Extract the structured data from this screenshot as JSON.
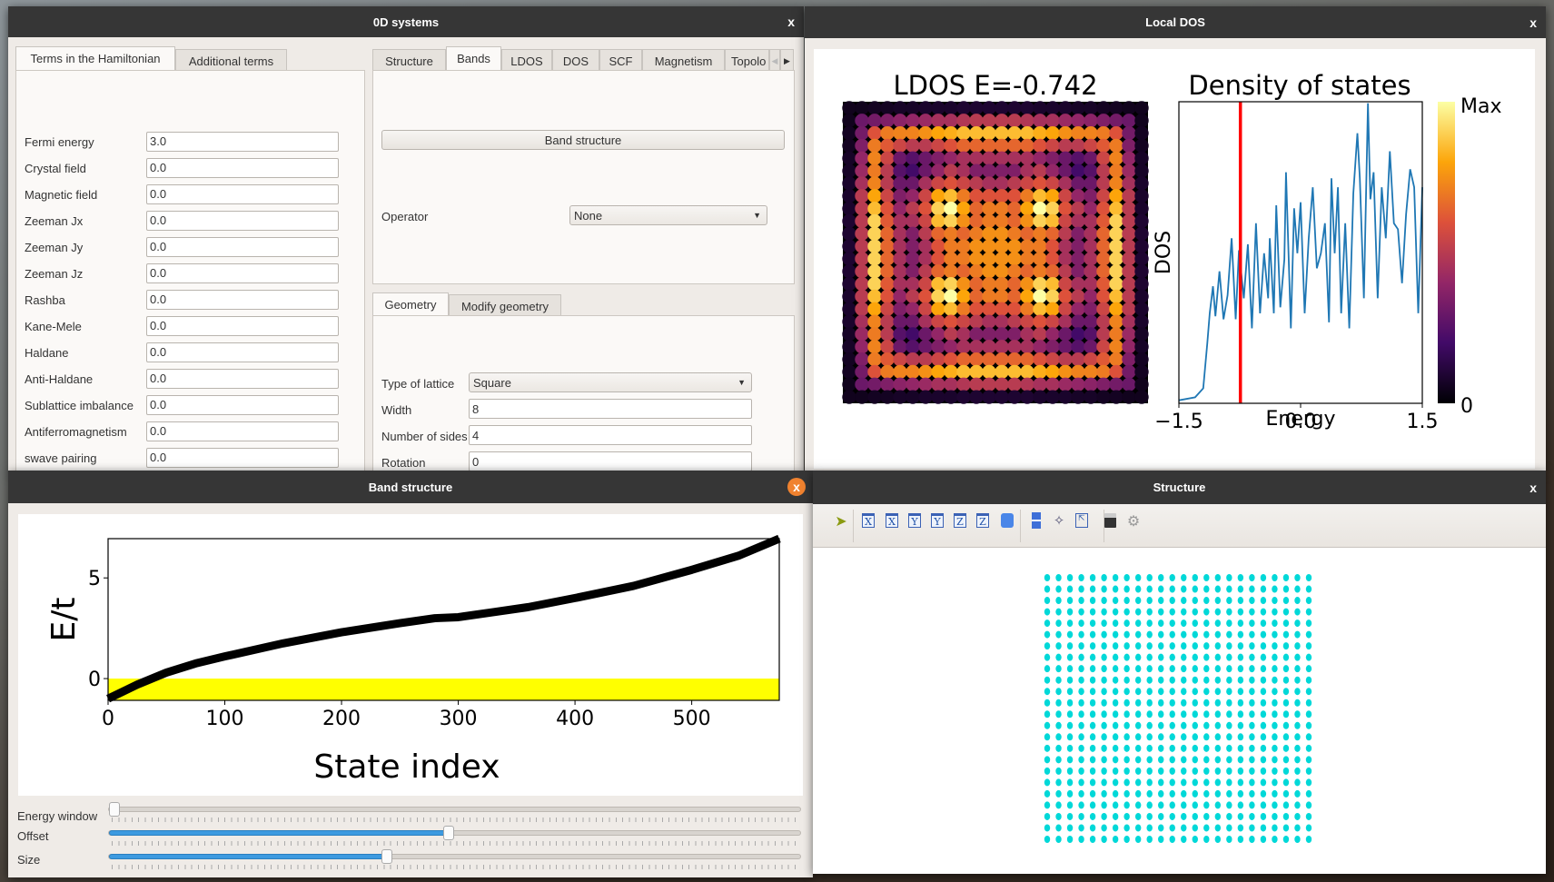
{
  "windows": {
    "systems": {
      "title": "0D systems"
    },
    "ldos": {
      "title": "Local DOS"
    },
    "bands": {
      "title": "Band structure"
    },
    "structure": {
      "title": "Structure"
    }
  },
  "close_glyph": "x",
  "left_tabs": [
    "Terms in the Hamiltonian",
    "Additional terms"
  ],
  "hamiltonian": [
    {
      "label": "Fermi energy",
      "value": "3.0"
    },
    {
      "label": "Crystal field",
      "value": "0.0"
    },
    {
      "label": "Magnetic field",
      "value": "0.0"
    },
    {
      "label": "Zeeman Jx",
      "value": "0.0"
    },
    {
      "label": "Zeeman Jy",
      "value": "0.0"
    },
    {
      "label": "Zeeman Jz",
      "value": "0.0"
    },
    {
      "label": "Rashba",
      "value": "0.0"
    },
    {
      "label": "Kane-Mele",
      "value": "0.0"
    },
    {
      "label": "Haldane",
      "value": "0.0"
    },
    {
      "label": "Anti-Haldane",
      "value": "0.0"
    },
    {
      "label": "Sublattice imbalance",
      "value": "0.0"
    },
    {
      "label": "Antiferromagnetism",
      "value": "0.0"
    },
    {
      "label": "swave pairing",
      "value": "0.0"
    }
  ],
  "right_tabs": [
    "Structure",
    "Bands",
    "LDOS",
    "DOS",
    "SCF",
    "Magnetism",
    "Topolo"
  ],
  "bands_tab": {
    "button": "Band structure",
    "operator_label": "Operator",
    "operator_value": "None"
  },
  "geometry_tabs": [
    "Geometry",
    "Modify geometry"
  ],
  "geometry": {
    "lattice_label": "Type of lattice",
    "lattice_value": "Square",
    "fields": [
      {
        "label": "Width",
        "value": "8"
      },
      {
        "label": "Number of sides",
        "value": "4"
      },
      {
        "label": "Rotation",
        "value": "0"
      }
    ]
  },
  "sliders": [
    {
      "label": "Energy window",
      "value": 0.0
    },
    {
      "label": "Offset",
      "value": 0.49
    },
    {
      "label": "Size",
      "value": 0.4
    }
  ],
  "structure_toolbar": [
    "select-icon",
    "view-x-icon",
    "view-minus-x-icon",
    "view-y-icon",
    "view-minus-y-icon",
    "view-z-icon",
    "view-minus-z-icon",
    "perspective-cube-icon",
    "layout-icon",
    "axes-icon",
    "fit-view-icon",
    "save-icon",
    "settings-icon"
  ],
  "structure_toolbar_glyphs": [
    "",
    "X",
    "X",
    "Y",
    "Y",
    "Z",
    "Z",
    "",
    "",
    "",
    "",
    "",
    ""
  ],
  "structure_lattice": {
    "rows": 24,
    "cols": 24,
    "color": "#00d8d8"
  },
  "chart_data": [
    {
      "type": "line",
      "id": "band-structure",
      "xlabel": "State index",
      "ylabel": "E/t",
      "xlim": [
        0,
        575
      ],
      "ylim": [
        -1.08,
        6.95
      ],
      "xticks": [
        0,
        100,
        200,
        300,
        400,
        500
      ],
      "yticks": [
        0,
        5
      ],
      "x": [
        0,
        25,
        50,
        75,
        100,
        150,
        200,
        250,
        280,
        300,
        330,
        360,
        400,
        450,
        500,
        540,
        575
      ],
      "y": [
        -1.0,
        -0.3,
        0.3,
        0.75,
        1.1,
        1.75,
        2.3,
        2.75,
        3.0,
        3.05,
        3.3,
        3.55,
        4.0,
        4.6,
        5.4,
        6.1,
        6.95
      ],
      "fill_below": 0,
      "fill_color": "#ffff00",
      "line_color": "#000000"
    },
    {
      "type": "heatmap",
      "id": "ldos",
      "title": "LDOS E=-0.742",
      "colormap": "inferno",
      "note_symmetry": "quarter mirrored",
      "quarter": [
        [
          0.05,
          0.05,
          0.06,
          0.06,
          0.07,
          0.07,
          0.08,
          0.08,
          0.08,
          0.09,
          0.09,
          0.09
        ],
        [
          0.05,
          0.3,
          0.32,
          0.35,
          0.38,
          0.4,
          0.42,
          0.45,
          0.45,
          0.48,
          0.5,
          0.5
        ],
        [
          0.06,
          0.32,
          0.6,
          0.7,
          0.72,
          0.72,
          0.75,
          0.8,
          0.82,
          0.85,
          0.85,
          0.85
        ],
        [
          0.06,
          0.35,
          0.7,
          0.62,
          0.55,
          0.5,
          0.5,
          0.55,
          0.6,
          0.65,
          0.65,
          0.65
        ],
        [
          0.07,
          0.4,
          0.72,
          0.55,
          0.3,
          0.25,
          0.3,
          0.35,
          0.4,
          0.45,
          0.45,
          0.45
        ],
        [
          0.07,
          0.42,
          0.7,
          0.5,
          0.25,
          0.2,
          0.3,
          0.4,
          0.5,
          0.45,
          0.35,
          0.35
        ],
        [
          0.08,
          0.45,
          0.72,
          0.5,
          0.3,
          0.3,
          0.45,
          0.55,
          0.6,
          0.55,
          0.5,
          0.45
        ],
        [
          0.08,
          0.5,
          0.8,
          0.55,
          0.35,
          0.4,
          0.55,
          0.8,
          0.85,
          0.7,
          0.6,
          0.6
        ],
        [
          0.08,
          0.5,
          0.85,
          0.6,
          0.4,
          0.5,
          0.6,
          0.9,
          1.0,
          0.8,
          0.65,
          0.7
        ],
        [
          0.09,
          0.5,
          0.9,
          0.62,
          0.45,
          0.45,
          0.55,
          0.85,
          0.9,
          0.75,
          0.65,
          0.7
        ],
        [
          0.09,
          0.5,
          0.9,
          0.65,
          0.45,
          0.35,
          0.5,
          0.65,
          0.7,
          0.65,
          0.7,
          0.75
        ],
        [
          0.09,
          0.5,
          0.9,
          0.65,
          0.45,
          0.35,
          0.45,
          0.6,
          0.7,
          0.7,
          0.75,
          0.75
        ]
      ],
      "colorbar": {
        "max_label": "Max",
        "min_label": "0"
      }
    },
    {
      "type": "line",
      "id": "dos",
      "title": "Density of states",
      "xlabel": "Energy",
      "ylabel": "DOS",
      "xlim": [
        -1.5,
        1.5
      ],
      "ylim": [
        0,
        1
      ],
      "xticks": [
        "−1.5",
        "0.0",
        "1.5"
      ],
      "xtick_values": [
        -1.5,
        0,
        1.5
      ],
      "marker_energy": -0.742,
      "marker_color": "#ff0000",
      "line_color": "#1f77b4",
      "x": [
        -1.5,
        -1.3,
        -1.2,
        -1.15,
        -1.12,
        -1.08,
        -1.05,
        -1.0,
        -0.95,
        -0.9,
        -0.85,
        -0.8,
        -0.76,
        -0.7,
        -0.65,
        -0.6,
        -0.55,
        -0.5,
        -0.45,
        -0.4,
        -0.38,
        -0.33,
        -0.3,
        -0.25,
        -0.2,
        -0.18,
        -0.12,
        -0.08,
        -0.04,
        0.0,
        0.05,
        0.1,
        0.15,
        0.2,
        0.25,
        0.3,
        0.35,
        0.38,
        0.42,
        0.46,
        0.5,
        0.55,
        0.6,
        0.65,
        0.7,
        0.73,
        0.78,
        0.83,
        0.86,
        0.9,
        0.95,
        1.0,
        1.05,
        1.1,
        1.15,
        1.2,
        1.25,
        1.3,
        1.35,
        1.4,
        1.45,
        1.5
      ],
      "y": [
        0.01,
        0.02,
        0.05,
        0.2,
        0.3,
        0.39,
        0.29,
        0.44,
        0.28,
        0.36,
        0.55,
        0.28,
        0.51,
        0.35,
        0.53,
        0.25,
        0.6,
        0.3,
        0.5,
        0.35,
        0.55,
        0.3,
        0.66,
        0.32,
        0.48,
        0.77,
        0.25,
        0.65,
        0.5,
        0.67,
        0.3,
        0.55,
        0.72,
        0.45,
        0.5,
        0.6,
        0.27,
        0.75,
        0.5,
        0.72,
        0.3,
        0.6,
        0.25,
        0.7,
        0.9,
        0.75,
        0.35,
        1.0,
        0.68,
        0.77,
        0.35,
        0.72,
        0.55,
        0.84,
        0.6,
        0.58,
        0.4,
        0.63,
        0.78,
        0.72,
        0.3,
        0.72
      ]
    }
  ]
}
